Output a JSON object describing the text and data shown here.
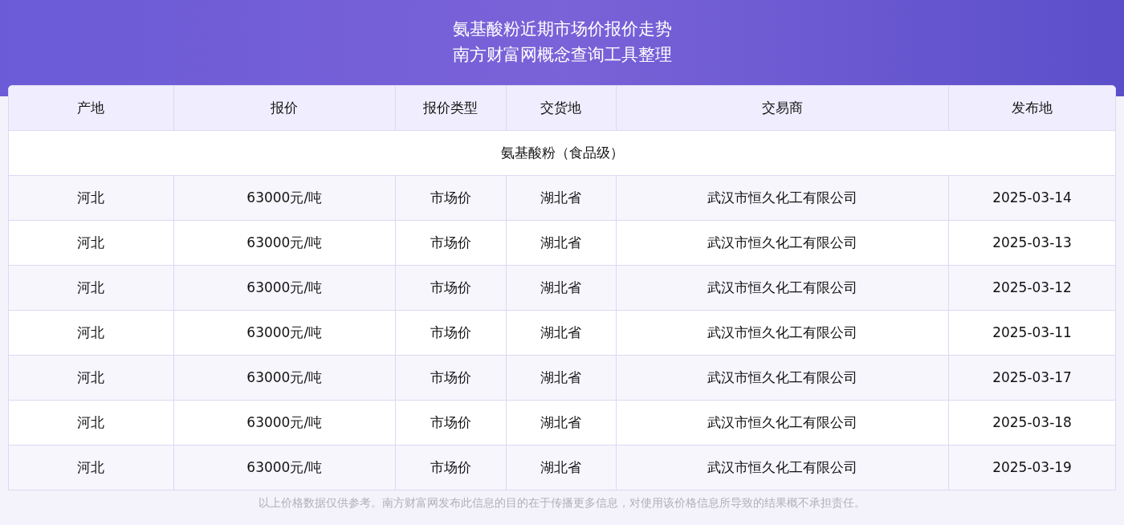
{
  "header": {
    "title_lines": [
      "氨基酸粉近期市场价报价走势",
      "南方财富网概念查询工具整理"
    ]
  },
  "table": {
    "columns": [
      "产地",
      "报价",
      "报价类型",
      "交货地",
      "交易商",
      "发布地"
    ],
    "group": "氨基酸粉（食品级）",
    "rows": [
      [
        "河北",
        "63000元/吨",
        "市场价",
        "湖北省",
        "武汉市恒久化工有限公司",
        "2025-03-14"
      ],
      [
        "河北",
        "63000元/吨",
        "市场价",
        "湖北省",
        "武汉市恒久化工有限公司",
        "2025-03-13"
      ],
      [
        "河北",
        "63000元/吨",
        "市场价",
        "湖北省",
        "武汉市恒久化工有限公司",
        "2025-03-12"
      ],
      [
        "河北",
        "63000元/吨",
        "市场价",
        "湖北省",
        "武汉市恒久化工有限公司",
        "2025-03-11"
      ],
      [
        "河北",
        "63000元/吨",
        "市场价",
        "湖北省",
        "武汉市恒久化工有限公司",
        "2025-03-17"
      ],
      [
        "河北",
        "63000元/吨",
        "市场价",
        "湖北省",
        "武汉市恒久化工有限公司",
        "2025-03-18"
      ],
      [
        "河北",
        "63000元/吨",
        "市场价",
        "湖北省",
        "武汉市恒久化工有限公司",
        "2025-03-19"
      ]
    ]
  },
  "footer": "以上价格数据仅供参考。南方财富网发布此信息的目的在于传播更多信息，对使用该价格信息所导致的结果概不承担责任。"
}
